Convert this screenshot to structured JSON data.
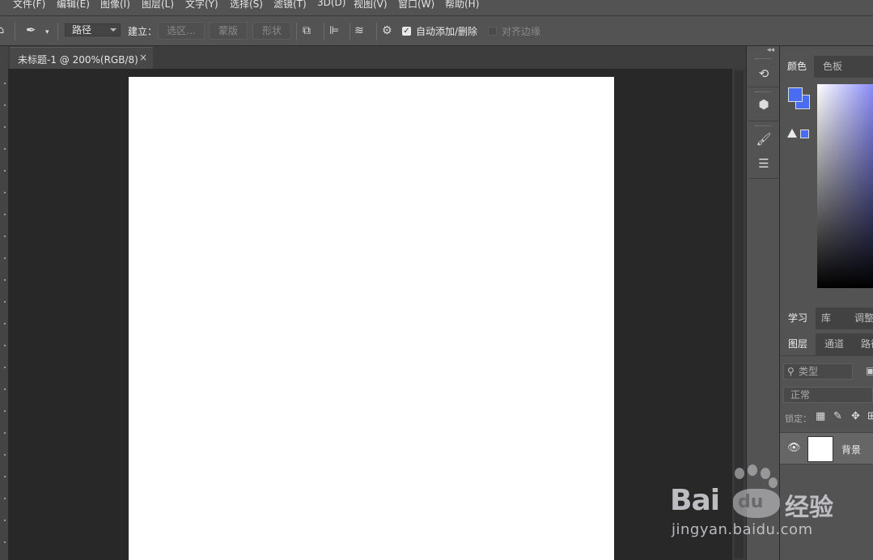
{
  "menu": [
    "文件(F)",
    "编辑(E)",
    "图像(I)",
    "图层(L)",
    "文字(Y)",
    "选择(S)",
    "滤镜(T)",
    "3D(D)",
    "视图(V)",
    "窗口(W)",
    "帮助(H)"
  ],
  "options": {
    "mode_value": "路径",
    "make_label": "建立：",
    "selection_btn": "选区...",
    "mask_btn": "蒙版",
    "shape_btn": "形状",
    "auto_add_label": "自动添加/删除",
    "align_edges_label": "对齐边缘"
  },
  "document": {
    "tab_title": "未标题-1 @ 200%(RGB/8)",
    "close_glyph": "×"
  },
  "panels": {
    "color_tabs": [
      "颜色",
      "色板"
    ],
    "mid_tabs": [
      "学习",
      "库",
      "调整"
    ],
    "layer_tabs": [
      "图层",
      "通道",
      "路径"
    ],
    "kind_placeholder": "类型",
    "blend_mode": "正常",
    "lock_label": "锁定：",
    "layer_name": "背景"
  },
  "colors": {
    "foreground": "#4a6cf0",
    "background": "#4a6cf0"
  },
  "watermark": {
    "brand": "Bai",
    "brand_du": "du",
    "brand_cn": "经验",
    "url": "jingyan.baidu.com"
  }
}
